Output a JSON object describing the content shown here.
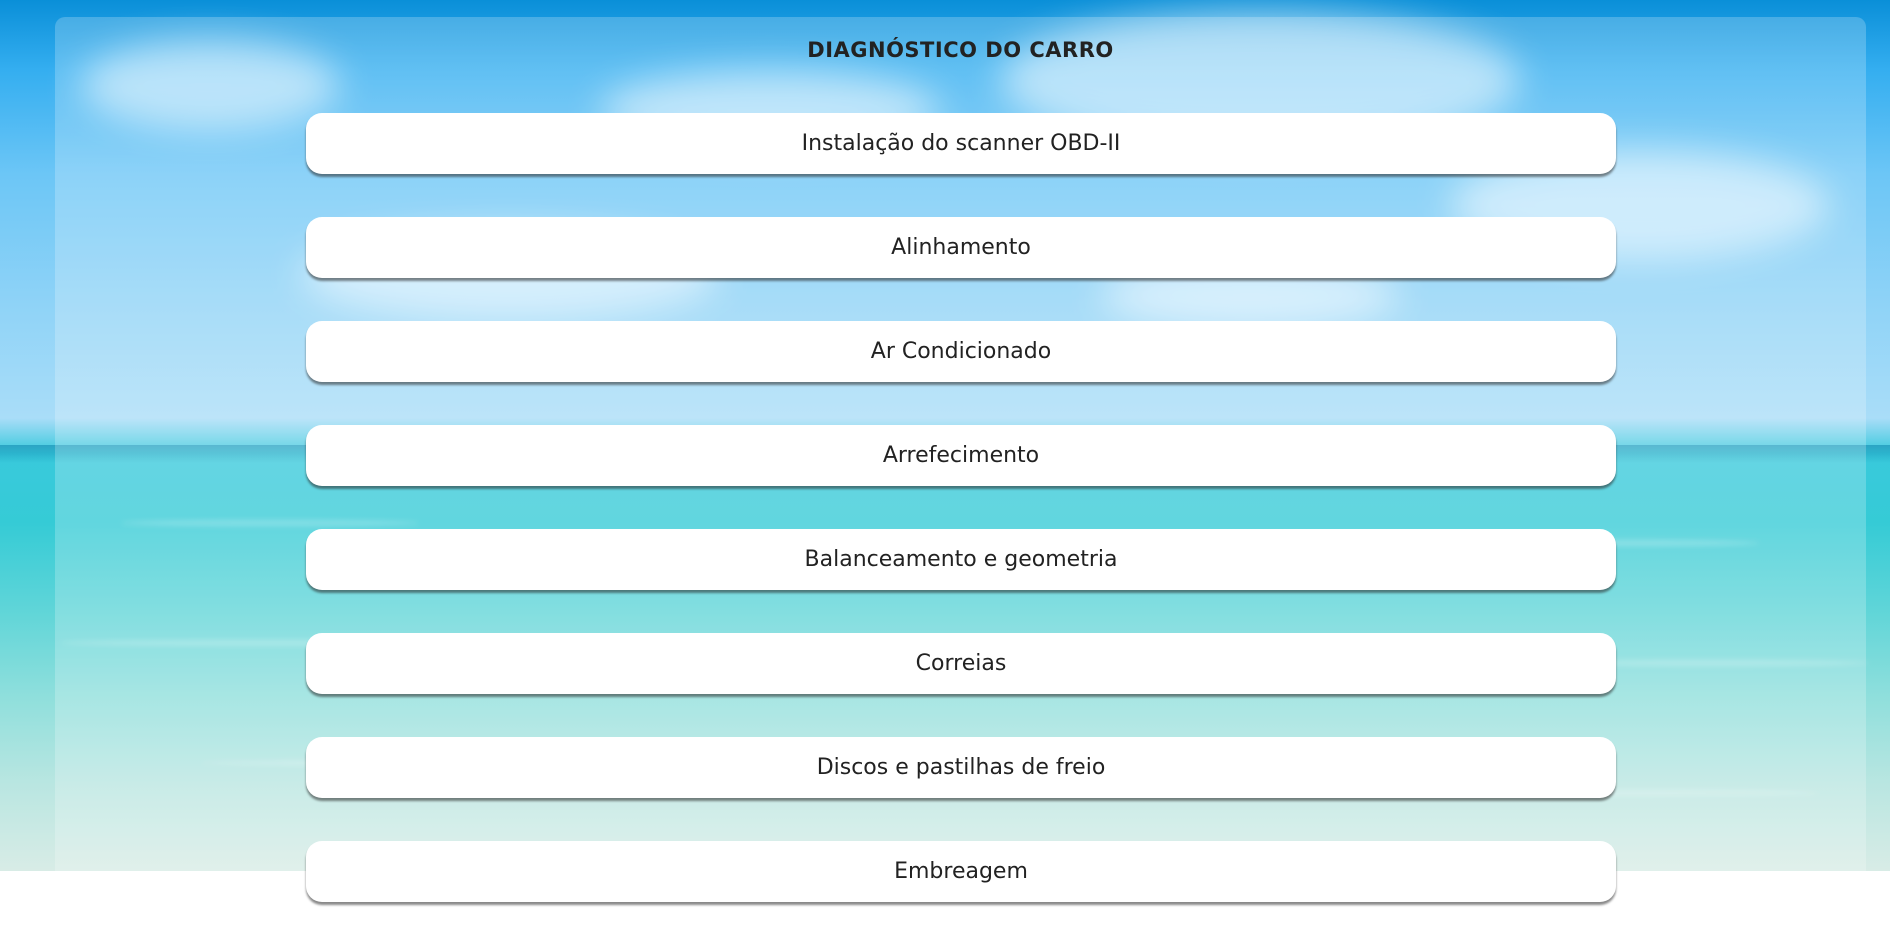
{
  "page": {
    "title": "DIAGNÓSTICO DO CARRO"
  },
  "menu": {
    "items": [
      {
        "label": "Instalação do scanner OBD-II"
      },
      {
        "label": "Alinhamento"
      },
      {
        "label": "Ar Condicionado"
      },
      {
        "label": "Arrefecimento"
      },
      {
        "label": "Balanceamento e geometria"
      },
      {
        "label": "Correias"
      },
      {
        "label": "Discos e pastilhas de freio"
      },
      {
        "label": "Embreagem"
      }
    ]
  },
  "colors": {
    "sky": "#6cc6f6",
    "sea": "#35cbd6",
    "panel": "rgba(255,255,255,0.22)",
    "button": "#ffffff",
    "text": "#222222"
  },
  "background": {
    "image": "beach-sky-sea-photo"
  }
}
